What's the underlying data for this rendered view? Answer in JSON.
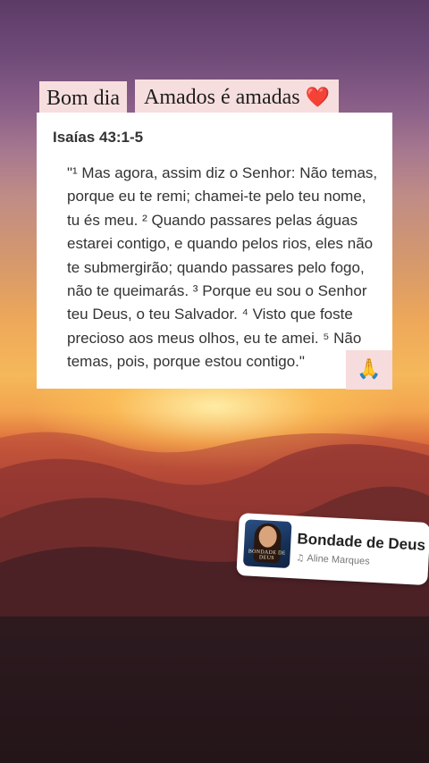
{
  "greeting": {
    "tag1": "Bom dia",
    "tag2": "Amados é amadas",
    "heart_icon": "❤️"
  },
  "bible_card": {
    "reference": "Isaías 43:1-5",
    "verse_text": "\"¹ Mas agora, assim diz o Senhor: Não temas, porque eu te remi; chamei-te pelo teu nome, tu és meu. ² Quando passares pelas águas estarei contigo, e quando pelos rios, eles não te submergirão; quando passares pelo fogo, não te queimarás. ³ Porque eu sou o Senhor teu Deus, o teu Salvador. ⁴ Visto que foste precioso aos meus olhos, eu te amei. ⁵ Não temas, pois, porque estou contigo.\""
  },
  "pray_sticker": {
    "icon": "🙏"
  },
  "music_sticker": {
    "song_title": "Bondade de Deus",
    "artist": "Aline Marques",
    "note_icon": "♫",
    "cover_text": "BONDADE DE DEUS"
  },
  "colors": {
    "tag_bg": "#f7dede",
    "heart": "#e0242a",
    "card_bg": "#ffffff",
    "text": "#333333"
  }
}
